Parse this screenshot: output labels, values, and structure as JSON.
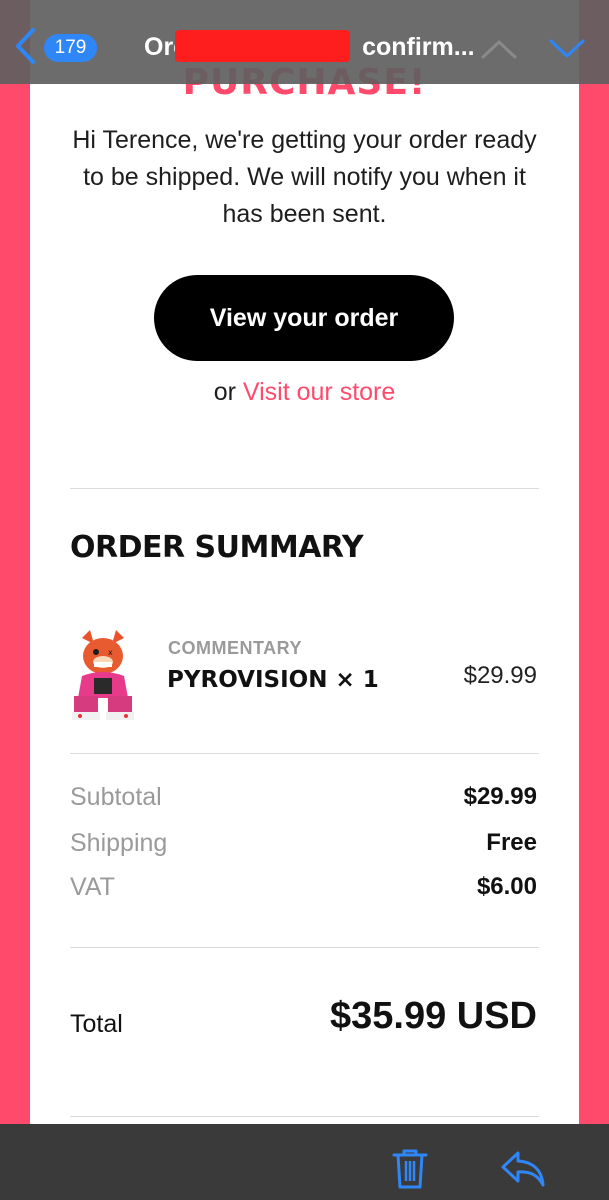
{
  "nav": {
    "unread_count": "179",
    "title_prefix": "Orc",
    "title_suffix": "confirm..."
  },
  "email": {
    "heading_partial": "PURCHASE!",
    "intro": "Hi Terence, we're getting your order ready to be shipped. We will notify you when it has been sent.",
    "view_order_button": "View your order",
    "or_text": "or",
    "visit_store_link": "Visit our store",
    "summary_title": "ORDER SUMMARY",
    "item": {
      "category": "COMMENTARY",
      "name": "PYROVISION × 1",
      "price": "$29.99"
    },
    "totals": {
      "subtotal_label": "Subtotal",
      "subtotal_value": "$29.99",
      "shipping_label": "Shipping",
      "shipping_value": "Free",
      "vat_label": "VAT",
      "vat_value": "$6.00",
      "total_label": "Total",
      "total_value": "$35.99 USD"
    }
  },
  "icons": {
    "back": "chevron-left-icon",
    "prev": "chevron-up-icon",
    "next": "chevron-down-icon",
    "trash": "trash-icon",
    "reply": "reply-icon"
  },
  "colors": {
    "brand_pink": "#ff4a6c",
    "ios_blue": "#2f86f6"
  }
}
